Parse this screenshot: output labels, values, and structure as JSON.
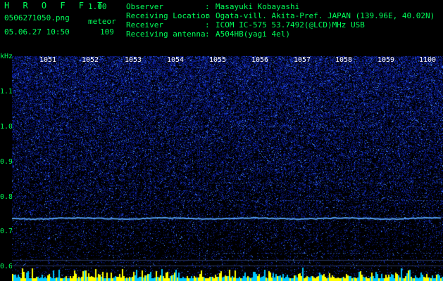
{
  "app": {
    "title": "H R O F F T",
    "version": "1.00",
    "file_name": "0506271050.png",
    "mode": "meteor",
    "datetime": "05.06.27 10:50",
    "count": "109"
  },
  "station": [
    {
      "label": "Observer",
      "value": "Masayuki Kobayashi"
    },
    {
      "label": "Receiving Location",
      "value": "Ogata-vill. Akita-Pref. JAPAN (139.96E, 40.02N)"
    },
    {
      "label": "Receiver",
      "value": "ICOM IC-575 53.7492(@LCD)MHz USB"
    },
    {
      "label": "Receiving antenna",
      "value": "A504HB(yagi 4el)"
    }
  ],
  "spectrogram": {
    "freq_unit": "kHz",
    "freq_ticks": [
      "1.1",
      "1.0",
      "0.9",
      "0.8",
      "0.7",
      "0.6"
    ],
    "time_ticks": [
      "1051",
      "1052",
      "1053",
      "1054",
      "1055",
      "1056",
      "1057",
      "1058",
      "1059",
      "1100"
    ],
    "colors": {
      "background": "#000000",
      "signal_low": "#0a1a8a",
      "signal_high": "#3a8cff",
      "text": "#00ff5a",
      "time_text": "#ffffff",
      "meter": "#ffff00"
    }
  }
}
